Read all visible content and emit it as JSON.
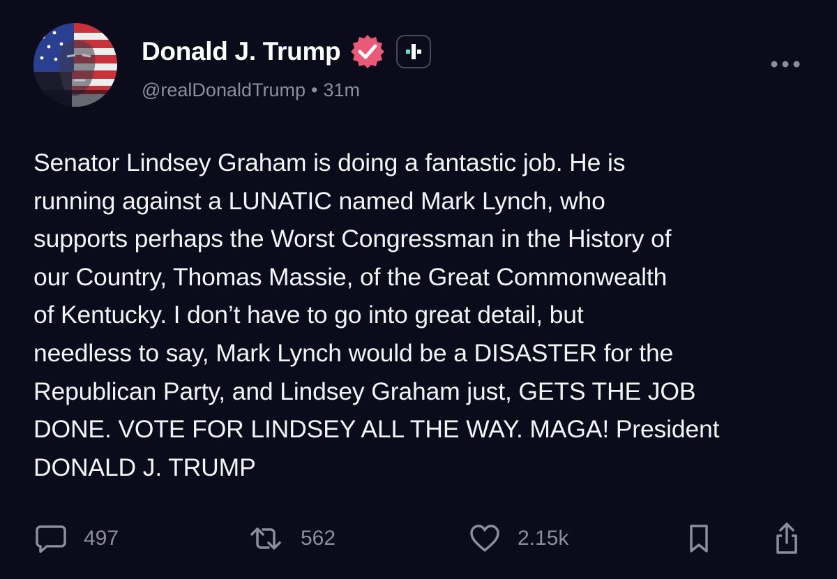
{
  "author": {
    "display_name": "Donald J. Trump",
    "handle": "@realDonaldTrump",
    "separator": "•",
    "time_ago": "31m"
  },
  "post": {
    "text": "Senator Lindsey Graham is doing a fantastic job. He is\nrunning against a LUNATIC named Mark Lynch, who\nsupports perhaps the Worst Congressman in the History of\nour Country, Thomas Massie, of the Great Commonwealth\nof Kentucky. I don’t have to go into great detail, but\nneedless to say, Mark Lynch would be a DISASTER for the\nRepublican Party, and Lindsey Graham just, GETS THE JOB\nDONE. VOTE FOR LINDSEY ALL THE WAY. MAGA! President\nDONALD J. TRUMP"
  },
  "actions": {
    "replies": "497",
    "reposts": "562",
    "likes": "2.15k"
  },
  "icons": {
    "verified": "verified-badge-icon",
    "plus": "plus-badge-icon",
    "more": "more-dots-icon",
    "reply": "comment-icon",
    "repost": "repost-icon",
    "like": "heart-icon",
    "bookmark": "bookmark-icon",
    "share": "share-icon"
  },
  "colors": {
    "background": "#0b0b1c",
    "text": "#f4f4f7",
    "muted": "#8d8d9e",
    "verified": "#e85a78",
    "plus_accent": "#5fe0c8"
  }
}
